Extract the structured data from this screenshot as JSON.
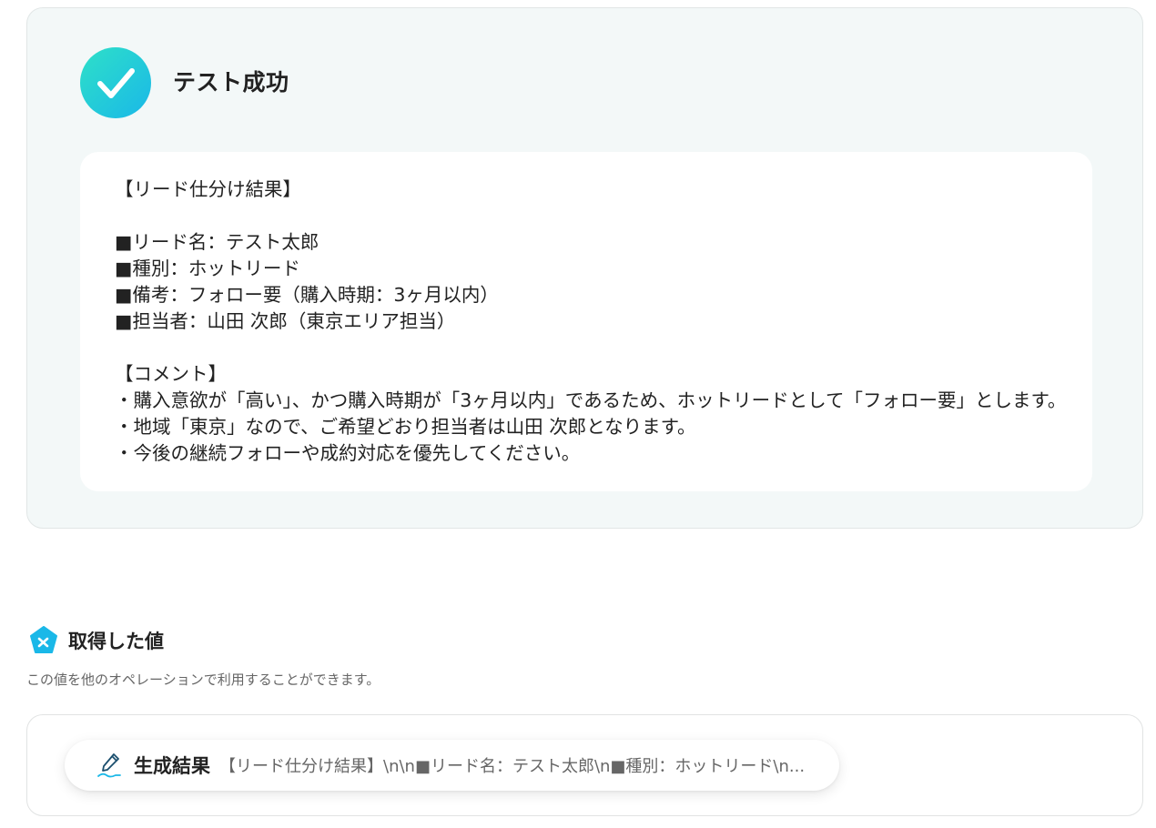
{
  "test_result": {
    "status_title": "テスト成功",
    "output_text": "【リード仕分け結果】\n\n■リード名：テスト太郎\n■種別：ホットリード\n■備考：フォロー要（購入時期：3ヶ月以内）\n■担当者：山田 次郎（東京エリア担当）\n\n【コメント】\n・購入意欲が「高い」、かつ購入時期が「3ヶ月以内」であるため、ホットリードとして「フォロー要」とします。\n・地域「東京」なので、ご希望どおり担当者は山田 次郎となります。\n・今後の継続フォローや成約対応を優先してください。"
  },
  "acquired_values": {
    "title": "取得した値",
    "description": "この値を他のオペレーションで利用することができます。",
    "items": [
      {
        "label": "生成結果",
        "value": "【リード仕分け結果】\\n\\n■リード名：テスト太郎\\n■種別：ホットリード\\n..."
      }
    ]
  },
  "icons": {
    "success": "check-circle-icon",
    "section": "pentagon-x-icon",
    "item": "pen-icon"
  },
  "colors": {
    "accent_teal": "#2ee0c8",
    "accent_blue": "#1ab8e8",
    "panel_bg": "#f3f8f8",
    "text_primary": "#222222",
    "text_secondary": "#666666"
  }
}
